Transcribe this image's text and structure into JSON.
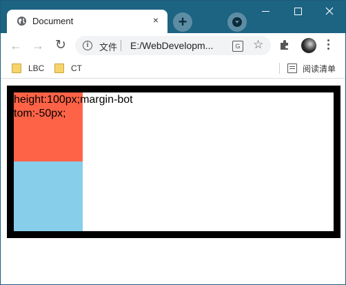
{
  "window": {
    "tab_title": "Document",
    "tab_close": "×",
    "new_tab": "+"
  },
  "toolbar": {
    "back": "←",
    "forward": "→",
    "reload": "↻",
    "security_label": "文件",
    "url": "E:/WebDevelopm...",
    "star": "☆"
  },
  "bookmarks": {
    "items": [
      {
        "label": "LBC"
      },
      {
        "label": "CT"
      }
    ],
    "reading_list": "阅读清单"
  },
  "page": {
    "text": "height:100px;margin-bottom:-50px;",
    "colors": {
      "border": "#000000",
      "red_box": "#ff6347",
      "blue_box": "#87ceeb"
    }
  }
}
